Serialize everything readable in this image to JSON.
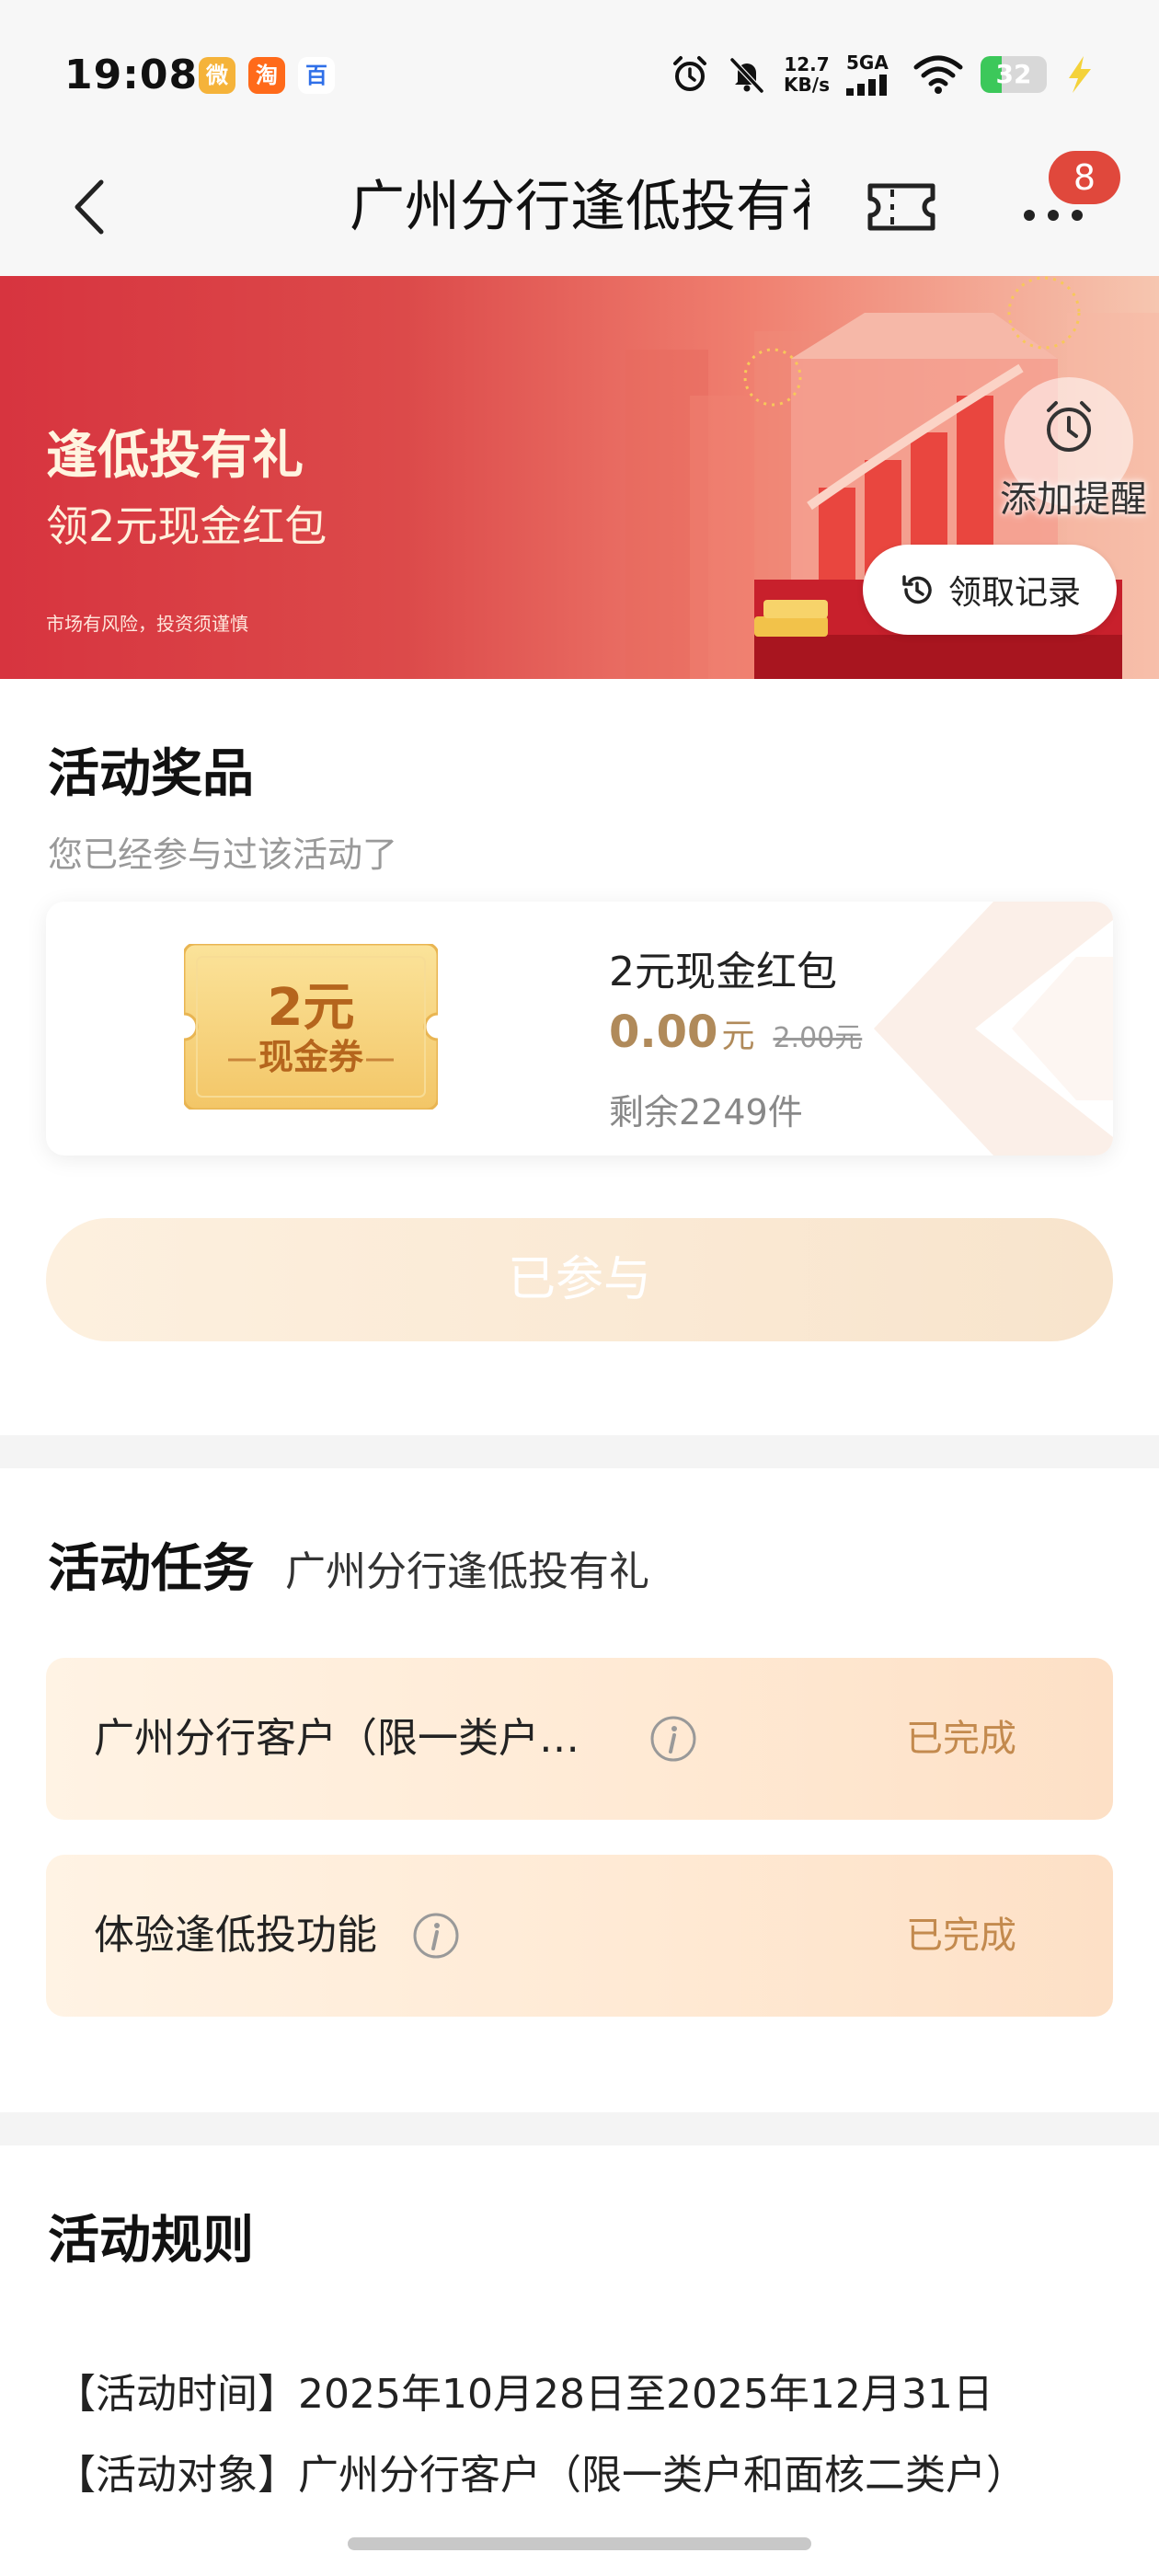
{
  "status_bar": {
    "time": "19:08",
    "apps": [
      "微",
      "淘",
      "百"
    ],
    "net_speed_value": "12.7",
    "net_speed_unit": "KB/s",
    "network": "5GA",
    "battery": "32",
    "battery_level": 0.32,
    "icons": [
      "alarm-icon",
      "mute-icon",
      "signal-icon",
      "wifi-icon",
      "charging-icon"
    ]
  },
  "nav": {
    "title": "广州分行逢低投有礼",
    "badge": "8",
    "icons": [
      "back-icon",
      "ticket-icon",
      "more-icon"
    ]
  },
  "banner": {
    "title": "逢低投有礼",
    "subtitle": "领2元现金红包",
    "risk_note": "市场有风险，投资须谨慎",
    "remind_label": "添加提醒",
    "records_label": "领取记录"
  },
  "prizes": {
    "heading": "活动奖品",
    "note": "您已经参与过该活动了",
    "coupon_amount": "2元",
    "coupon_name": "现金券",
    "prize_name": "2元现金红包",
    "price_now": "0.00",
    "price_unit": "元",
    "price_old": "2.00元",
    "stock": "剩余2249件",
    "joined_button": "已参与"
  },
  "tasks": {
    "heading": "活动任务",
    "subheading": "广州分行逢低投有礼",
    "items": [
      {
        "label": "广州分行客户（限一类户…",
        "status": "已完成"
      },
      {
        "label": "体验逢低投功能",
        "status": "已完成"
      }
    ]
  },
  "rules": {
    "heading": "活动规则",
    "lines": [
      "【活动时间】2025年10月28日至2025年12月31日",
      "【活动对象】广州分行客户（限一类户和面核二类户）"
    ]
  },
  "colors": {
    "banner_red": "#d7343f",
    "accent_gold": "#b08a5a",
    "task_status": "#c38a4e",
    "badge_red": "#e0483c"
  }
}
